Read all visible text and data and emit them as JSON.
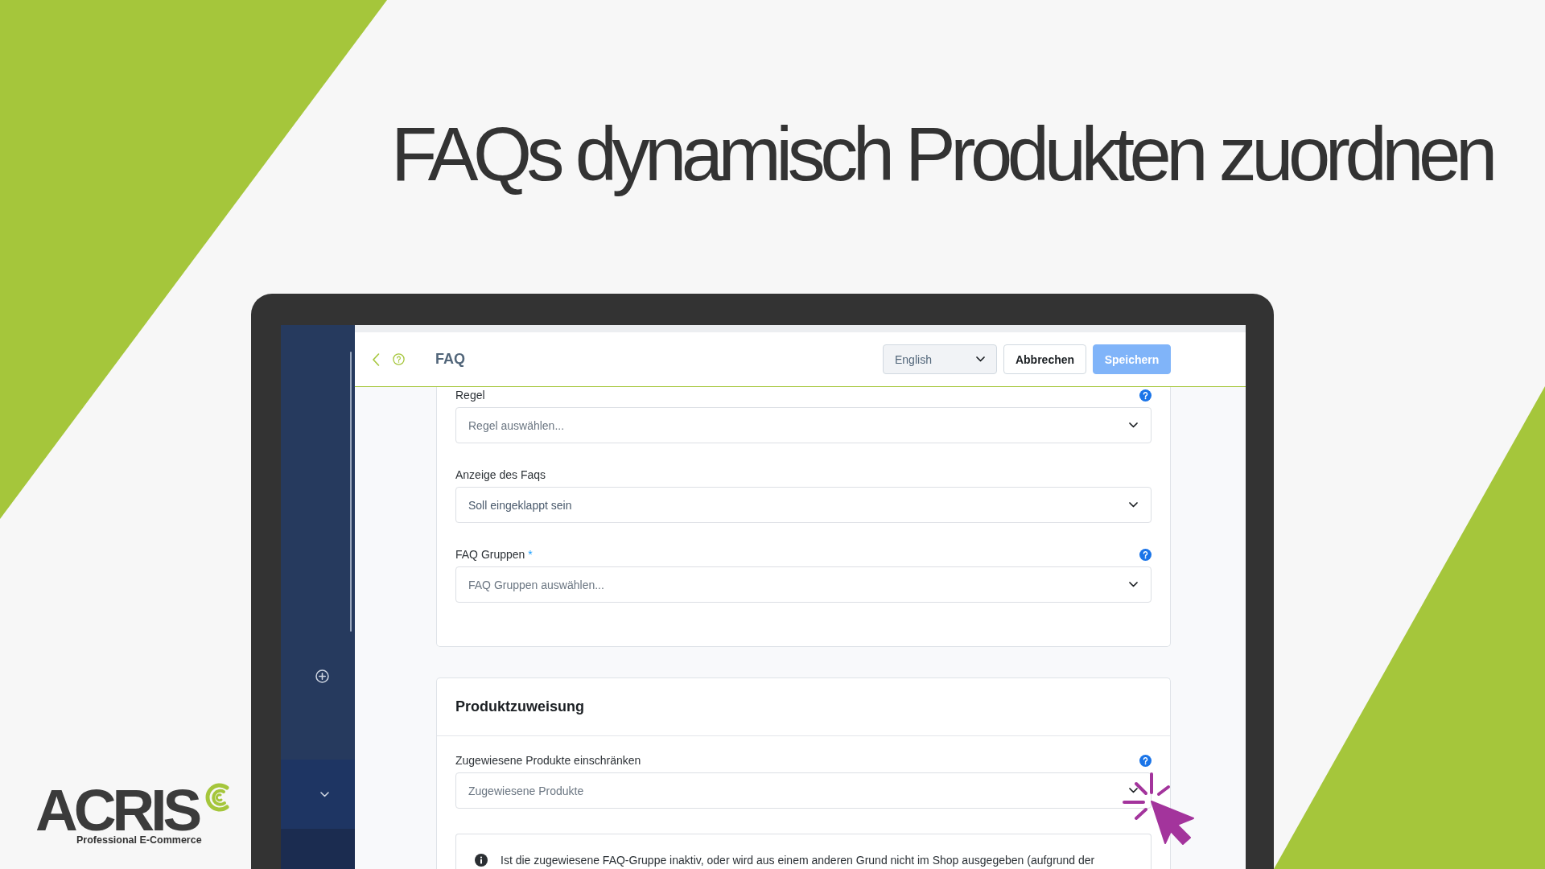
{
  "headline": "FAQs dynamisch Produkten zuordnen",
  "header": {
    "title": "FAQ",
    "language": "English",
    "buttons": [
      {
        "label": "Abbrechen",
        "kind": "secondary"
      },
      {
        "label": "Speichern",
        "kind": "primary"
      }
    ]
  },
  "rule_card": {
    "fields": [
      {
        "label": "Regel",
        "help": true,
        "placeholder": "Regel auswählen..."
      },
      {
        "label": "Anzeige des Faqs",
        "help": false,
        "value": "Soll eingeklappt sein"
      },
      {
        "label": "FAQ Gruppen",
        "required_mark": "*",
        "help": true,
        "placeholder": "FAQ Gruppen auswählen..."
      }
    ]
  },
  "product_assignment": {
    "heading": "Produktzuweisung",
    "fields": [
      {
        "label": "Zugewiesene Produkte einschränken",
        "help": true,
        "placeholder": "Zugewiesene Produkte"
      }
    ],
    "notice": "Ist die zugewiesene FAQ-Gruppe inaktiv, oder wird aus einem anderen Grund nicht im Shop ausgegeben (aufgrund der"
  },
  "logo": {
    "wordmark": "ACRIS",
    "tagline": "Professional E-Commerce"
  }
}
